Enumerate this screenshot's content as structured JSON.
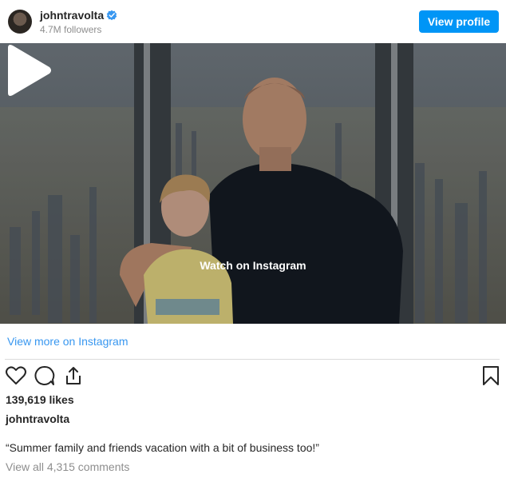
{
  "header": {
    "username": "johntravolta",
    "followers": "4.7M followers",
    "view_profile_label": "View profile"
  },
  "media": {
    "watch_label": "Watch on Instagram",
    "icon": "play-icon"
  },
  "links": {
    "view_more": "View more on Instagram"
  },
  "post": {
    "likes": "139,619 likes",
    "caption_user": "johntravolta",
    "caption": "“Summer family and friends vacation with a bit of business too!”",
    "comments": "View all 4,315 comments"
  },
  "icons": [
    "verified-badge-icon",
    "heart-icon",
    "comment-icon",
    "share-icon",
    "bookmark-icon"
  ],
  "colors": {
    "accent": "#0095f6",
    "link": "#3897f0",
    "muted": "#8e8e8e",
    "text": "#262626"
  }
}
